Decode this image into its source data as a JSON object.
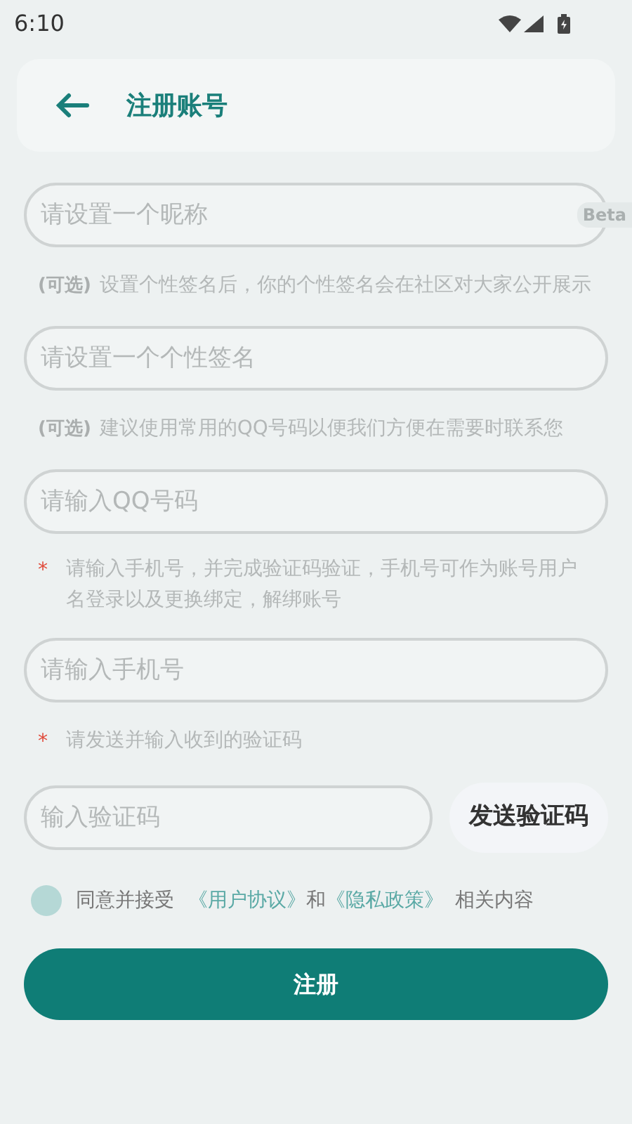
{
  "status_bar": {
    "time": "6:10"
  },
  "header": {
    "title": "注册账号"
  },
  "beta_badge": "Beta",
  "form": [
    {
      "kind": "field",
      "placeholder": "请设置一个昵称"
    },
    {
      "kind": "optional_hint",
      "mark": "(可选)",
      "text": "设置个性签名后，你的个性签名会在社区对大家公开展示"
    },
    {
      "kind": "field",
      "placeholder": "请设置一个个性签名"
    },
    {
      "kind": "optional_hint",
      "mark": "(可选)",
      "text": "建议使用常用的QQ号码以便我们方便在需要时联系您"
    },
    {
      "kind": "field",
      "placeholder": "请输入QQ号码"
    },
    {
      "kind": "required_hint",
      "mark": "*",
      "text": "请输入手机号，并完成验证码验证，手机号可作为账号用户名登录以及更换绑定，解绑账号"
    },
    {
      "kind": "field",
      "placeholder": "请输入手机号"
    },
    {
      "kind": "required_hint",
      "mark": "*",
      "text": "请发送并输入收到的验证码"
    },
    {
      "kind": "code_field",
      "placeholder": "输入验证码",
      "button": "发送验证码"
    }
  ],
  "agreement": {
    "checked": false,
    "prefix": "同意并接受",
    "link_1": "《用户协议》",
    "joiner": "和",
    "link_2": "《隐私政策》",
    "suffix": "相关内容"
  },
  "submit": "注册"
}
